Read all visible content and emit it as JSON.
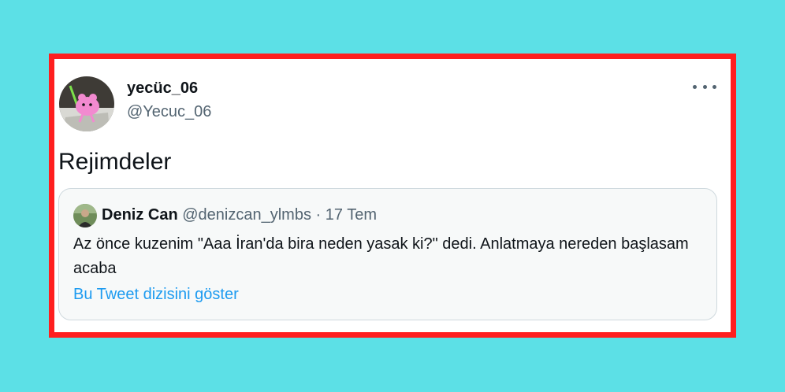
{
  "tweet": {
    "author_name": "yecüc_06",
    "author_handle": "@Yecuc_06",
    "text": "Rejimdeler",
    "more_icon": "more-horizontal-icon"
  },
  "quote": {
    "author_name": "Deniz Can",
    "author_handle": "@denizcan_ylmbs",
    "separator": "·",
    "date": "17 Tem",
    "text": "Az önce kuzenim \"Aaa İran'da bira neden yasak ki?\" dedi. Anlatmaya nereden başlasam acaba",
    "thread_link": "Bu Tweet dizisini göster"
  },
  "colors": {
    "background": "#5ce0e6",
    "frame_border": "#ff1f1f",
    "link": "#1d9bf0",
    "secondary_text": "#536471"
  }
}
